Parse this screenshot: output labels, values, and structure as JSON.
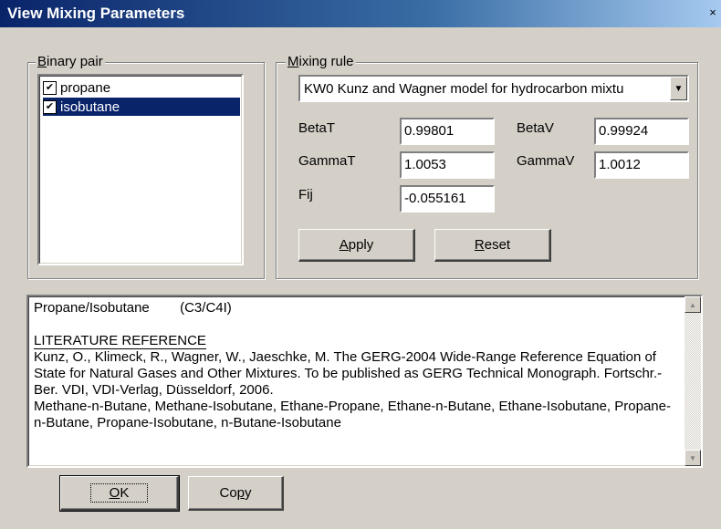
{
  "window": {
    "title": "View Mixing Parameters",
    "close_glyph": "×"
  },
  "binary_pair": {
    "legend_accel": "B",
    "legend_rest": "inary pair",
    "items": [
      {
        "label": "propane",
        "checked": true,
        "selected": false
      },
      {
        "label": "isobutane",
        "checked": true,
        "selected": true
      }
    ]
  },
  "mixing_rule": {
    "legend_accel": "M",
    "legend_rest": "ixing rule",
    "selected": "KW0  Kunz and Wagner model for hydrocarbon mixtu",
    "params": {
      "betaT": {
        "label": "BetaT",
        "value": "0.99801"
      },
      "betaV": {
        "label": "BetaV",
        "value": "0.99924"
      },
      "gammaT": {
        "label": "GammaT",
        "value": "1.0053"
      },
      "gammaV": {
        "label": "GammaV",
        "value": "1.0012"
      },
      "fij": {
        "label": "Fij",
        "value": "-0.055161"
      }
    },
    "apply_accel": "A",
    "apply_rest": "pply",
    "reset_accel": "R",
    "reset_rest": "eset"
  },
  "info": {
    "heading": "Propane/Isobutane        (C3/C4I)",
    "lit_title": "LITERATURE REFERENCE",
    "body": "Kunz, O., Klimeck, R., Wagner, W., Jaeschke, M. The GERG-2004 Wide-Range Reference Equation of State for Natural Gases and Other Mixtures. To be published as GERG Technical Monograph. Fortschr.-Ber. VDI, VDI-Verlag, Düsseldorf, 2006.\nMethane-n-Butane, Methane-Isobutane, Ethane-Propane, Ethane-n-Butane, Ethane-Isobutane, Propane-n-Butane, Propane-Isobutane, n-Butane-Isobutane"
  },
  "footer": {
    "ok_accel": "O",
    "ok_rest": "K",
    "copy_pre": "Co",
    "copy_accel": "p",
    "copy_rest": "y"
  },
  "icons": {
    "check": "✔",
    "dropdown": "▼",
    "scroll_up": "▲",
    "scroll_down": "▼"
  }
}
